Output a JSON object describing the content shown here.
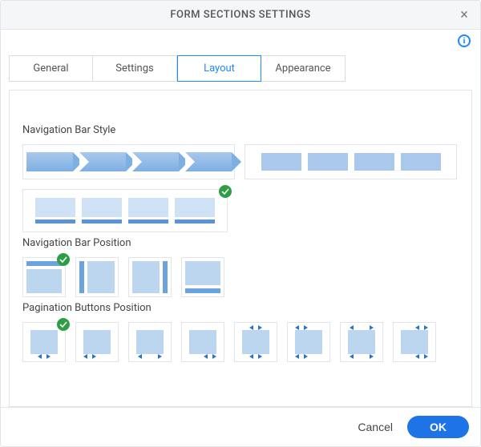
{
  "dialog": {
    "title": "FORM SECTIONS SETTINGS"
  },
  "tabs": [
    {
      "label": "General",
      "active": false
    },
    {
      "label": "Settings",
      "active": false
    },
    {
      "label": "Layout",
      "active": true
    },
    {
      "label": "Appearance",
      "active": false
    }
  ],
  "sections": {
    "nav_style": {
      "label": "Navigation Bar Style",
      "options": [
        "arrows",
        "blocks",
        "underline"
      ],
      "selected": "underline"
    },
    "nav_position": {
      "label": "Navigation Bar Position",
      "options": [
        "top",
        "left",
        "right",
        "bottom"
      ],
      "selected": "top"
    },
    "pagination": {
      "label": "Pagination Buttons Position",
      "options": [
        "bottom-center",
        "bottom-left",
        "bottom-middle",
        "bottom-right",
        "top-and-bottom-center",
        "top-and-bottom-left",
        "top-and-bottom-middle",
        "top-and-bottom-right"
      ],
      "selected": "bottom-center"
    }
  },
  "footer": {
    "cancel_label": "Cancel",
    "ok_label": "OK"
  }
}
